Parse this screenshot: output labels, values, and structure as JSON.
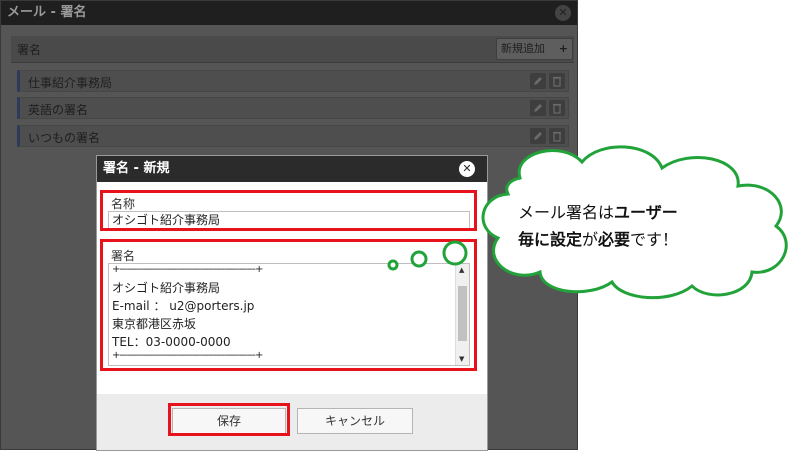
{
  "window": {
    "title": "メール - 署名",
    "close": "✕"
  },
  "signatures_panel": {
    "header_label": "署名",
    "add_button_label": "新規追加",
    "add_button_icon": "+",
    "items": [
      {
        "label": "仕事紹介事務局"
      },
      {
        "label": "英語の署名"
      },
      {
        "label": "いつもの署名"
      }
    ]
  },
  "dialog": {
    "title": "署名 - 新規",
    "close": "✕",
    "name_label": "名称",
    "name_value": "オシゴト紹介事務局",
    "signature_label": "署名",
    "signature_lines": [
      "+----------------------------------------------------+",
      "オシゴト紹介事務局",
      "E-mail ： u2@porters.jp",
      "東京都港区赤坂",
      "TEL：03-0000-0000",
      "+----------------------------------------------------+"
    ],
    "save_label": "保存",
    "cancel_label": "キャンセル"
  },
  "callout": {
    "line1_normal": "メール署名は",
    "line1_bold": "ユーザー",
    "line2_bold1": "毎に設定",
    "line2_normal1": "が",
    "line2_bold2": "必要",
    "line2_normal2": "です！"
  },
  "colors": {
    "highlight": "#e8121c",
    "callout_border": "#21a33a",
    "dialog_title_bg": "#2b2b2b"
  },
  "icons": [
    "close-icon",
    "plus-icon",
    "pencil-icon",
    "trash-icon"
  ]
}
